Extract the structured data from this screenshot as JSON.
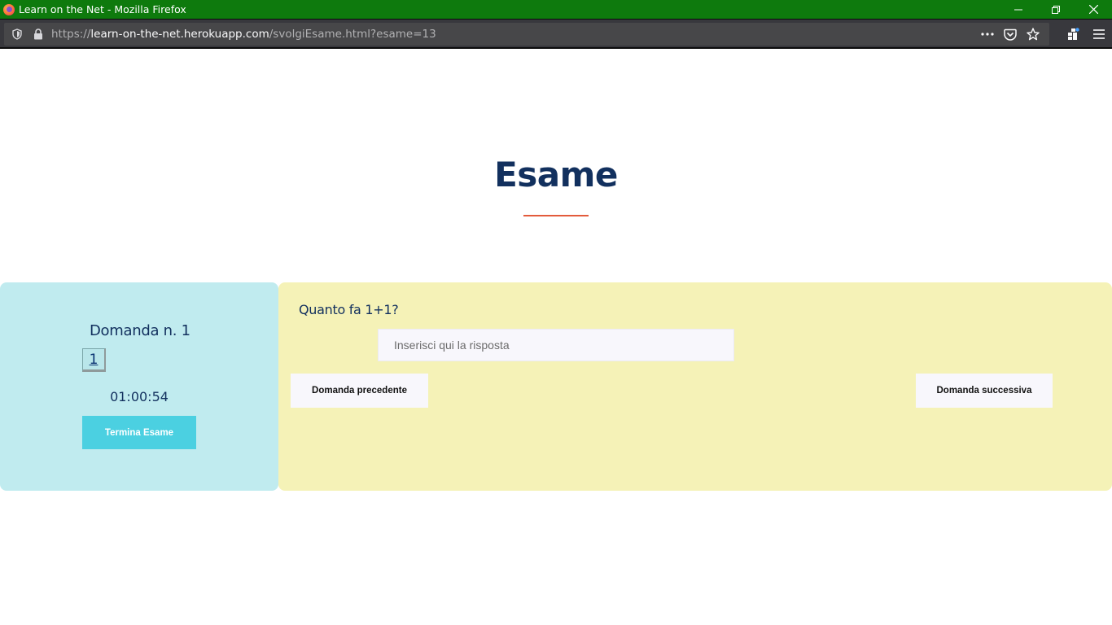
{
  "browser": {
    "window_title": "Learn on the Net - Mozilla Firefox",
    "url_prefix": "https://",
    "url_host": "learn-on-the-net.herokuapp.com",
    "url_path": "/svolgiEsame.html?esame=13",
    "colors": {
      "titlebar": "#0e7a0d",
      "toolbar": "#38383d",
      "urlbar": "#474749"
    }
  },
  "page": {
    "title": "Esame",
    "accent_color": "#e35b3c"
  },
  "sidebar": {
    "question_label": "Domanda n. 1",
    "question_buttons": [
      "1"
    ],
    "timer": "01:00:54",
    "end_exam_label": "Termina Esame"
  },
  "main": {
    "question_text": "Quanto fa 1+1?",
    "answer_placeholder": "Inserisci qui la risposta",
    "answer_value": "",
    "prev_label": "Domanda precedente",
    "next_label": "Domanda successiva"
  }
}
